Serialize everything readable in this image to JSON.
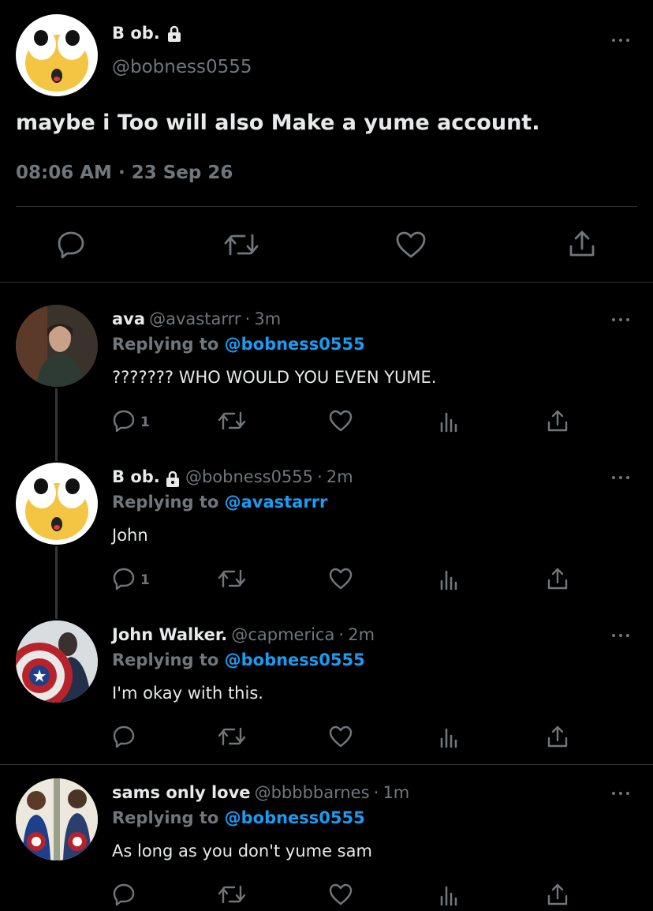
{
  "main_tweet": {
    "name": "B ob.",
    "handle": "@bobness0555",
    "text": "maybe i Too will also Make a yume account.",
    "time": "08:06 AM",
    "date": "23 Sep 26"
  },
  "replies": [
    {
      "name": "ava",
      "handle": "@avastarrr",
      "age": "3m",
      "replying_prefix": "Replying to",
      "replying_to": "@bobness0555",
      "text": "??????? WHO WOULD YOU EVEN YUME.",
      "reply_count": "1"
    },
    {
      "name": "B ob.",
      "handle": "@bobness0555",
      "age": "2m",
      "replying_prefix": "Replying to",
      "replying_to": "@avastarrr",
      "text": "John",
      "reply_count": "1"
    },
    {
      "name": "John Walker.",
      "handle": "@capmerica",
      "age": "2m",
      "replying_prefix": "Replying to",
      "replying_to": "@bobness0555",
      "text": "I'm okay with this.",
      "reply_count": ""
    },
    {
      "name": "sams only love",
      "handle": "@bbbbbarnes",
      "age": "1m",
      "replying_prefix": "Replying to",
      "replying_to": "@bobness0555",
      "text": "As long as you don't yume sam",
      "reply_count": ""
    }
  ],
  "separator": "·",
  "colors": {
    "background": "#000000",
    "accent": "#1d9bf0",
    "muted": "#71767b",
    "divider": "#2f3336"
  }
}
